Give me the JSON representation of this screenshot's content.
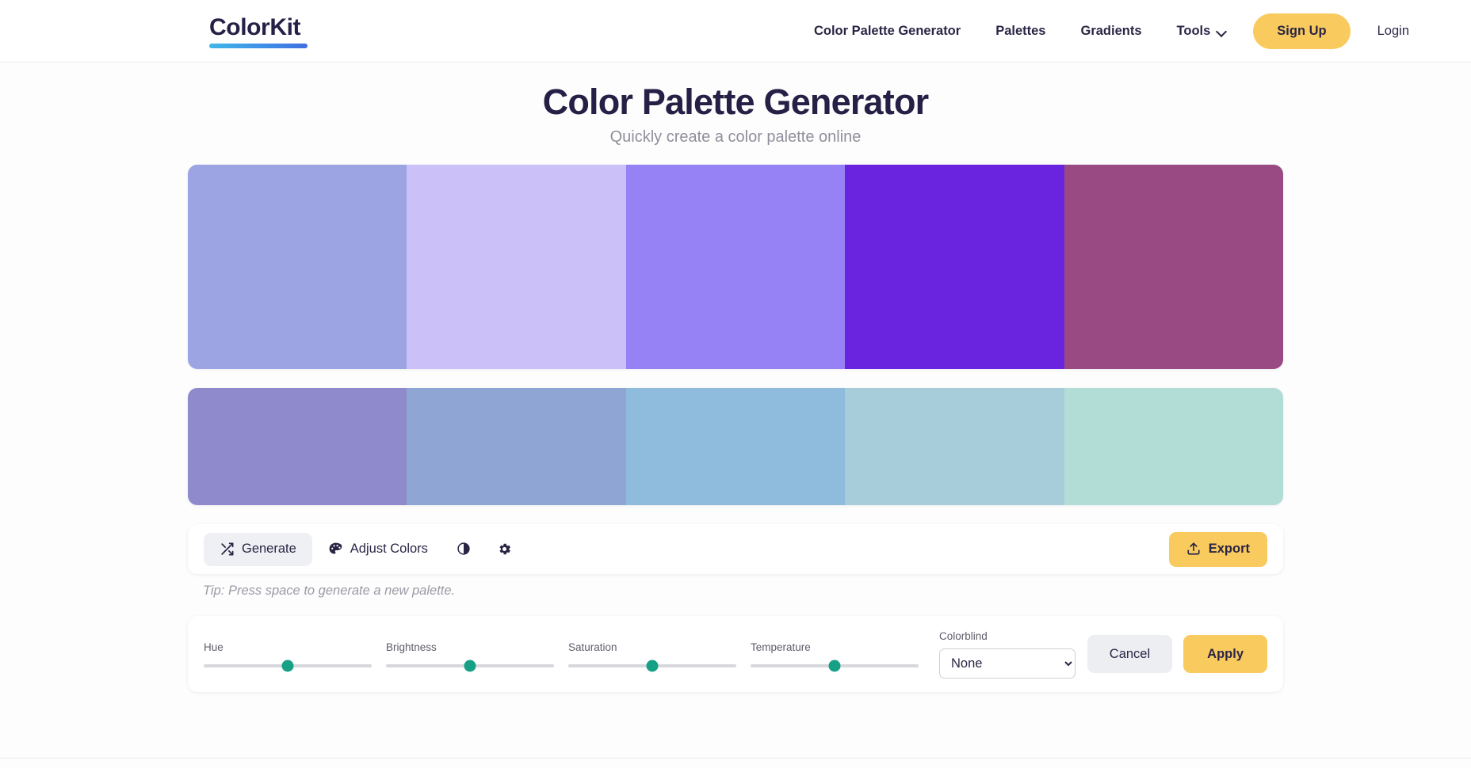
{
  "header": {
    "logo_text": "ColorKit",
    "nav": [
      {
        "label": "Color Palette Generator",
        "name": "nav-color-palette-generator"
      },
      {
        "label": "Palettes",
        "name": "nav-palettes"
      },
      {
        "label": "Gradients",
        "name": "nav-gradients"
      },
      {
        "label": "Tools",
        "name": "nav-tools"
      }
    ],
    "signup_label": "Sign Up",
    "login_label": "Login"
  },
  "hero": {
    "title": "Color Palette Generator",
    "subtitle": "Quickly create a color palette online"
  },
  "palette_row1": [
    "#9ca4e3",
    "#cbc0f7",
    "#9682f4",
    "#6a24e0",
    "#9a4a82"
  ],
  "palette_row2": [
    "#8e8acb",
    "#8fa6d4",
    "#8fbcdc",
    "#a7cdda",
    "#b2dcd6"
  ],
  "toolbar": {
    "generate_label": "Generate",
    "adjust_label": "Adjust Colors",
    "contrast_label": "",
    "settings_label": "",
    "export_label": "Export"
  },
  "tip": "Tip: Press space to generate a new palette.",
  "controls": {
    "sliders": [
      {
        "label": "Hue",
        "value": 50
      },
      {
        "label": "Brightness",
        "value": 50
      },
      {
        "label": "Saturation",
        "value": 50
      },
      {
        "label": "Temperature",
        "value": 50
      }
    ],
    "colorblind_label": "Colorblind",
    "colorblind_value": "None",
    "colorblind_options": [
      "None"
    ],
    "cancel_label": "Cancel",
    "apply_label": "Apply"
  },
  "colors": {
    "accent": "#f9cb5e",
    "text_dark": "#262046",
    "knob": "#16a085"
  }
}
